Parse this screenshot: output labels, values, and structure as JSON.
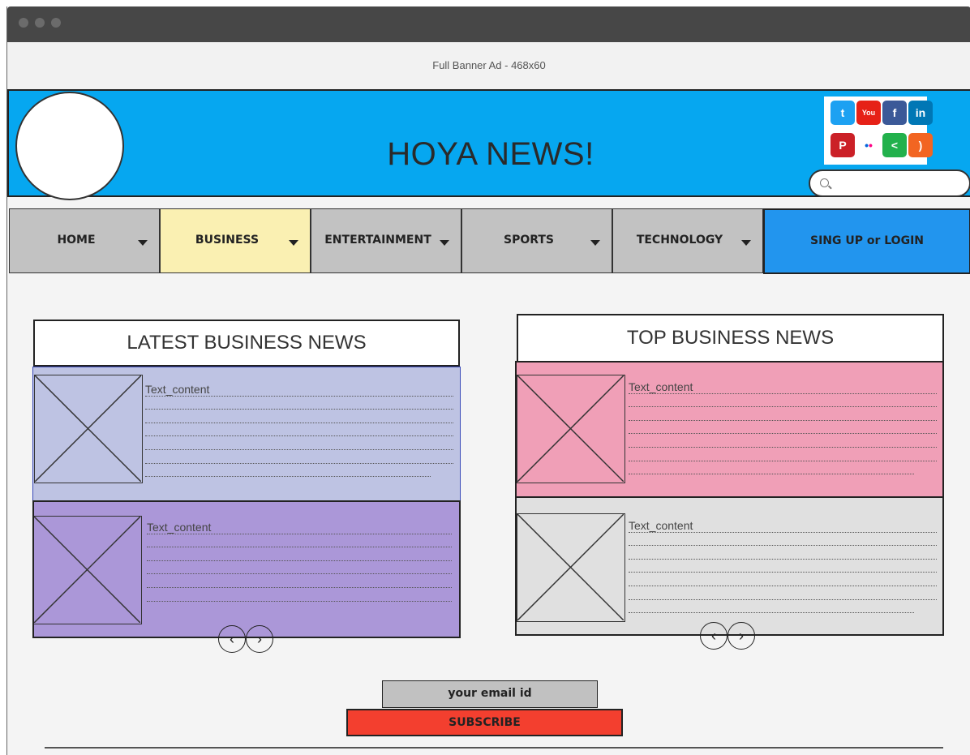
{
  "ad_banner": {
    "text": "Full Banner Ad - 468x60"
  },
  "header": {
    "title": "HOYA NEWS!",
    "search_placeholder": ""
  },
  "social_icons": [
    {
      "name": "twitter-icon",
      "glyph": "t",
      "color": "#1da1f2"
    },
    {
      "name": "youtube-icon",
      "glyph": "You",
      "color": "#e62117"
    },
    {
      "name": "facebook-icon",
      "glyph": "f",
      "color": "#3b5998"
    },
    {
      "name": "linkedin-icon",
      "glyph": "in",
      "color": "#0077b5"
    },
    {
      "name": "pinterest-icon",
      "glyph": "P",
      "color": "#cb2027"
    },
    {
      "name": "flickr-icon",
      "glyph": "••",
      "color": "#ffffff"
    },
    {
      "name": "share-icon",
      "glyph": "<",
      "color": "#22b14c"
    },
    {
      "name": "rss-icon",
      "glyph": ")",
      "color": "#f26522"
    }
  ],
  "nav": {
    "items": [
      {
        "label": "HOME"
      },
      {
        "label": "BUSINESS"
      },
      {
        "label": "ENTERTAINMENT"
      },
      {
        "label": "SPORTS"
      },
      {
        "label": "TECHNOLOGY"
      }
    ],
    "active_index": 1,
    "login_label": "SING UP or LOGIN"
  },
  "latest": {
    "title": "LATEST BUSINESS NEWS",
    "cards": [
      {
        "text": "Text_content",
        "color": "#bec3e3"
      },
      {
        "text": "Text_content",
        "color": "#ab97d8"
      }
    ]
  },
  "top": {
    "title": "TOP BUSINESS NEWS",
    "cards": [
      {
        "text": "Text_content",
        "color": "#f09fb7"
      },
      {
        "text": "Text_content",
        "color": "#e0e0e0"
      }
    ]
  },
  "pager": {
    "prev": "‹",
    "next": "›"
  },
  "subscribe": {
    "email_placeholder": "your email id",
    "button_label": "SUBSCRIBE"
  }
}
